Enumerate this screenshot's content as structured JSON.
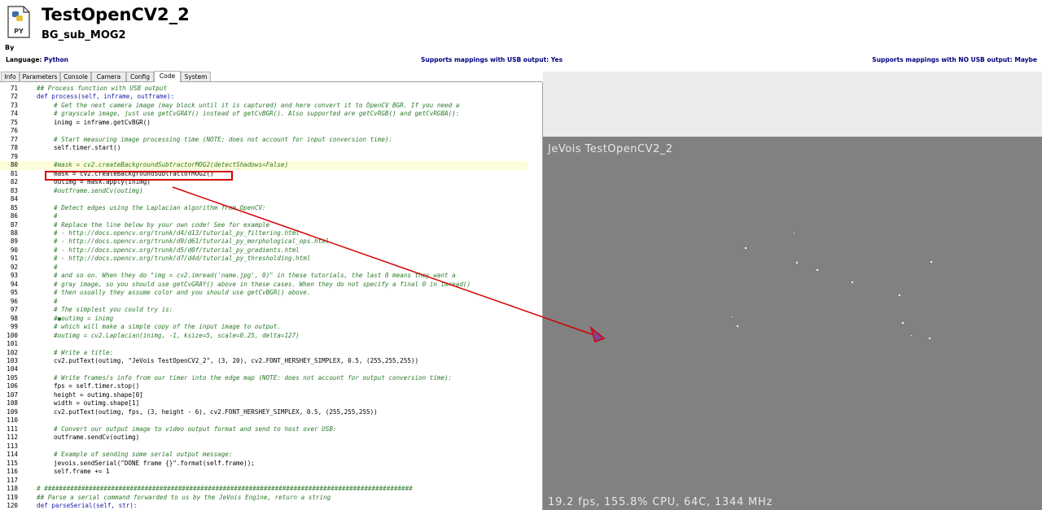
{
  "header": {
    "file_icon_label": "PY",
    "title": "TestOpenCV2_2",
    "subtitle": "BG_sub_MOG2",
    "by_label": "By"
  },
  "info_bar": {
    "language_label": "Language: ",
    "language_value": "Python",
    "usb_mapping": "Supports mappings with USB output: Yes",
    "no_usb_mapping": "Supports mappings with NO USB output: Maybe"
  },
  "tabs": [
    {
      "label": "Info"
    },
    {
      "label": "Parameters"
    },
    {
      "label": "Console"
    },
    {
      "label": "Camera"
    },
    {
      "label": "Config"
    },
    {
      "label": "Code",
      "active": true
    },
    {
      "label": "System"
    }
  ],
  "code": {
    "lines": [
      {
        "n": "71",
        "indent": 0,
        "style": "comment",
        "text": "## Process function with USB output"
      },
      {
        "n": "72",
        "indent": 0,
        "style": "kw",
        "text": "def process(self, inframe, outframe):"
      },
      {
        "n": "73",
        "indent": 1,
        "style": "comment",
        "text": "# Get the next camera image (may block until it is captured) and here convert it to OpenCV BGR. If you need a"
      },
      {
        "n": "74",
        "indent": 1,
        "style": "comment",
        "text": "# grayscale image, just use getCvGRAY() instead of getCvBGR(). Also supported are getCvRGB() and getCvRGBA():"
      },
      {
        "n": "75",
        "indent": 1,
        "style": "plain",
        "text": "inimg = inframe.getCvBGR()"
      },
      {
        "n": "76",
        "indent": 0,
        "style": "plain",
        "text": ""
      },
      {
        "n": "77",
        "indent": 1,
        "style": "comment",
        "text": "# Start measuring image processing time (NOTE: does not account for input conversion time):"
      },
      {
        "n": "78",
        "indent": 1,
        "style": "plain",
        "text": "self.timer.start()"
      },
      {
        "n": "79",
        "indent": 0,
        "style": "plain",
        "text": ""
      },
      {
        "n": "80",
        "indent": 1,
        "style": "comment",
        "text": "#mask = cv2.createBackgroundSubtractorMOG2(detectShadows=False)",
        "hl": true
      },
      {
        "n": "81",
        "indent": 1,
        "style": "plain",
        "text": "mask = cv2.createBackgroundSubtractorMOG2()"
      },
      {
        "n": "82",
        "indent": 1,
        "style": "plain",
        "text": "outimg = mask.apply(inimg)"
      },
      {
        "n": "83",
        "indent": 1,
        "style": "comment",
        "text": "#outframe.sendCv(outimg)"
      },
      {
        "n": "84",
        "indent": 0,
        "style": "plain",
        "text": ""
      },
      {
        "n": "85",
        "indent": 1,
        "style": "comment",
        "text": "# Detect edges using the Laplacian algorithm from OpenCV:"
      },
      {
        "n": "86",
        "indent": 1,
        "style": "comment",
        "text": "#"
      },
      {
        "n": "87",
        "indent": 1,
        "style": "comment",
        "text": "# Replace the line below by your own code! See for example"
      },
      {
        "n": "88",
        "indent": 1,
        "style": "comment",
        "text": "# - http://docs.opencv.org/trunk/d4/d13/tutorial_py_filtering.html"
      },
      {
        "n": "89",
        "indent": 1,
        "style": "comment",
        "text": "# - http://docs.opencv.org/trunk/d9/d61/tutorial_py_morphological_ops.html"
      },
      {
        "n": "90",
        "indent": 1,
        "style": "comment",
        "text": "# - http://docs.opencv.org/trunk/d5/d0f/tutorial_py_gradients.html"
      },
      {
        "n": "91",
        "indent": 1,
        "style": "comment",
        "text": "# - http://docs.opencv.org/trunk/d7/d4d/tutorial_py_thresholding.html"
      },
      {
        "n": "92",
        "indent": 1,
        "style": "comment",
        "text": "#"
      },
      {
        "n": "93",
        "indent": 1,
        "style": "comment",
        "text": "# and so on. When they do \"img = cv2.imread('name.jpg', 0)\" in these tutorials, the last 0 means they want a"
      },
      {
        "n": "94",
        "indent": 1,
        "style": "comment",
        "text": "# gray image, so you should use getCvGRAY() above in these cases. When they do not specify a final 0 in imread()"
      },
      {
        "n": "95",
        "indent": 1,
        "style": "comment",
        "text": "# then usually they assume color and you should use getCvBGR() above."
      },
      {
        "n": "96",
        "indent": 1,
        "style": "comment",
        "text": "#"
      },
      {
        "n": "97",
        "indent": 1,
        "style": "comment",
        "text": "# The simplest you could try is:"
      },
      {
        "n": "98",
        "indent": 1,
        "style": "comment",
        "text": "#●outimg = inimg"
      },
      {
        "n": "99",
        "indent": 1,
        "style": "comment",
        "text": "# which will make a simple copy of the input image to output."
      },
      {
        "n": "100",
        "indent": 1,
        "style": "comment",
        "text": "#outimg = cv2.Laplacian(inimg, -1, ksize=5, scale=0.25, delta=127)"
      },
      {
        "n": "101",
        "indent": 0,
        "style": "plain",
        "text": ""
      },
      {
        "n": "102",
        "indent": 1,
        "style": "comment",
        "text": "# Write a title:"
      },
      {
        "n": "103",
        "indent": 1,
        "style": "plain",
        "text": "cv2.putText(outimg, \"JeVois TestOpenCV2_2\", (3, 20), cv2.FONT_HERSHEY_SIMPLEX, 0.5, (255,255,255))"
      },
      {
        "n": "104",
        "indent": 0,
        "style": "plain",
        "text": ""
      },
      {
        "n": "105",
        "indent": 1,
        "style": "comment",
        "text": "# Write frames/s info from our timer into the edge map (NOTE: does not account for output conversion time):"
      },
      {
        "n": "106",
        "indent": 1,
        "style": "plain",
        "text": "fps = self.timer.stop()"
      },
      {
        "n": "107",
        "indent": 1,
        "style": "plain",
        "text": "height = outimg.shape[0]"
      },
      {
        "n": "108",
        "indent": 1,
        "style": "plain",
        "text": "width = outimg.shape[1]"
      },
      {
        "n": "109",
        "indent": 1,
        "style": "plain",
        "text": "cv2.putText(outimg, fps, (3, height - 6), cv2.FONT_HERSHEY_SIMPLEX, 0.5, (255,255,255))"
      },
      {
        "n": "110",
        "indent": 0,
        "style": "plain",
        "text": ""
      },
      {
        "n": "111",
        "indent": 1,
        "style": "comment",
        "text": "# Convert our output image to video output format and send to host over USB:"
      },
      {
        "n": "112",
        "indent": 1,
        "style": "plain",
        "text": "outframe.sendCv(outimg)"
      },
      {
        "n": "113",
        "indent": 0,
        "style": "plain",
        "text": ""
      },
      {
        "n": "114",
        "indent": 1,
        "style": "comment",
        "text": "# Example of sending some serial output message:"
      },
      {
        "n": "115",
        "indent": 1,
        "style": "plain",
        "text": "jevois.sendSerial(\"DONE frame {}\".format(self.frame));"
      },
      {
        "n": "116",
        "indent": 1,
        "style": "plain",
        "text": "self.frame += 1"
      },
      {
        "n": "117",
        "indent": 0,
        "style": "plain",
        "text": ""
      },
      {
        "n": "118",
        "indent": 0,
        "style": "comment",
        "text": "# ###################################################################################################"
      },
      {
        "n": "119",
        "indent": 0,
        "style": "comment",
        "text": "## Parse a serial command forwarded to us by the JeVois Engine, return a string"
      },
      {
        "n": "120",
        "indent": 0,
        "style": "kw",
        "text": "def parseSerial(self, str):"
      }
    ]
  },
  "scrollbar": {
    "up_arrow": "▲",
    "grip": "≡"
  },
  "video": {
    "title": "JeVois TestOpenCV2_2",
    "fps_text": "19.2 fps, 155.8% CPU, 64C, 1344 MHz"
  },
  "colors": {
    "annotation_red": "#d40000",
    "comment_green": "#2c7a2c",
    "video_gray": "#818181",
    "line_highlight": "#fefdd9"
  }
}
